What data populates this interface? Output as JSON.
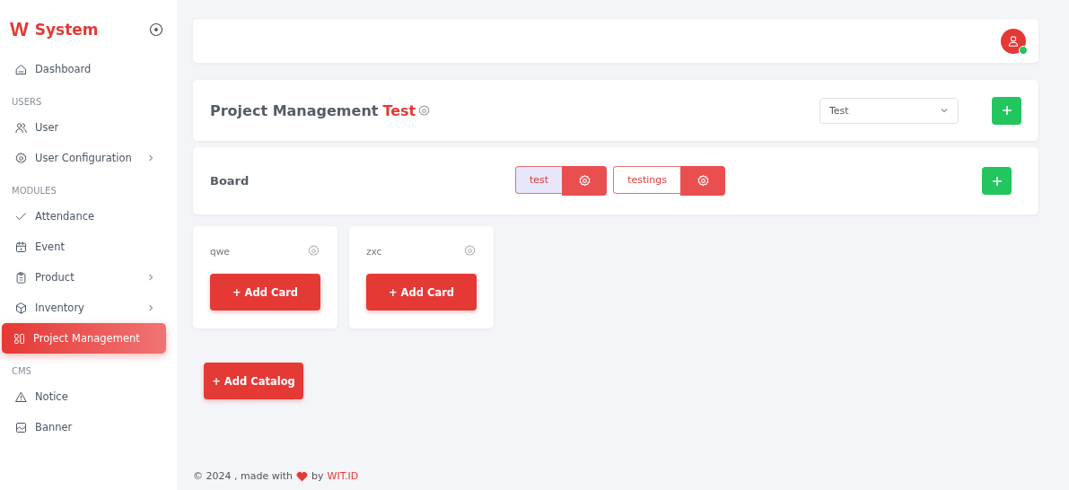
{
  "sidebar": {
    "logo": "W",
    "title": "System",
    "items": [
      {
        "kind": "link",
        "label": "Dashboard",
        "expandable": false,
        "selected": false
      },
      {
        "kind": "section",
        "label": "USERS"
      },
      {
        "kind": "link",
        "label": "User",
        "expandable": false,
        "selected": false
      },
      {
        "kind": "link",
        "label": "User Configuration",
        "expandable": true,
        "selected": false
      },
      {
        "kind": "section",
        "label": "MODULES"
      },
      {
        "kind": "link",
        "label": "Attendance",
        "expandable": false,
        "selected": false
      },
      {
        "kind": "link",
        "label": "Event",
        "expandable": false,
        "selected": false
      },
      {
        "kind": "link",
        "label": "Product",
        "expandable": true,
        "selected": false
      },
      {
        "kind": "link",
        "label": "Inventory",
        "expandable": true,
        "selected": false
      },
      {
        "kind": "link",
        "label": "Project Management",
        "expandable": false,
        "selected": true
      },
      {
        "kind": "section",
        "label": "CMS"
      },
      {
        "kind": "link",
        "label": "Notice",
        "expandable": false,
        "selected": false
      },
      {
        "kind": "link",
        "label": "Banner",
        "expandable": false,
        "selected": false
      }
    ]
  },
  "topbar": {
    "user_online": true
  },
  "project": {
    "title": "Project Management",
    "name": "Test",
    "select_value": "Test"
  },
  "board": {
    "label": "Board",
    "boards": [
      {
        "label": "test",
        "selected": true
      },
      {
        "label": "testings",
        "selected": false
      }
    ]
  },
  "catalogs": [
    {
      "name": "qwe",
      "button": "+ Add Card"
    },
    {
      "name": "zxc",
      "button": "+ Add Card"
    }
  ],
  "add_catalog": "+ Add Catalog",
  "footer": {
    "prefix": "© 2024 , made with",
    "by": "by",
    "link": "WIT.ID"
  }
}
